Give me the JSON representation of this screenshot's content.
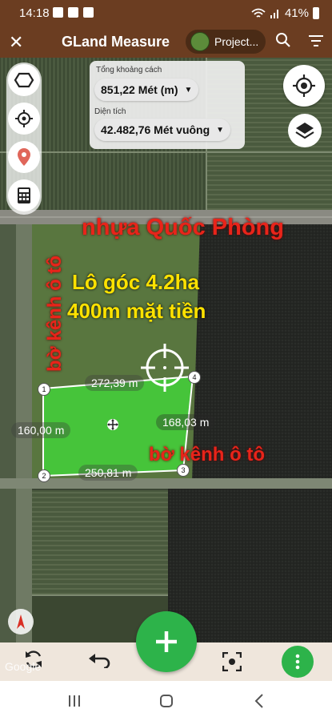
{
  "status": {
    "time": "14:18",
    "battery": "41%"
  },
  "appbar": {
    "title": "GLand Measure",
    "project_label": "Project..."
  },
  "measure": {
    "distance_label": "Tổng khoảng cách",
    "distance_value": "851,22 Mét (m)",
    "area_label": "Diện tích",
    "area_value": "42.482,76 Mét vuông"
  },
  "overlay_text": {
    "road_top": "nhựa Quốc Phòng",
    "left_vertical": "bờ kênh ô tô",
    "lot_line1": "Lô góc 4.2ha",
    "lot_line2": "400m mặt tiền",
    "canal_right": "bờ kênh ô tô"
  },
  "polygon": {
    "vertices": [
      "1",
      "2",
      "3",
      "4"
    ],
    "edges": [
      "272,39 m",
      "168,03 m",
      "250,81 m",
      "160,00 m"
    ]
  },
  "map_attribution": "Google",
  "colors": {
    "brand": "#6b3d21",
    "accent": "#2db34a",
    "overlay_red": "#e8241a",
    "overlay_yellow": "#ffe200"
  }
}
